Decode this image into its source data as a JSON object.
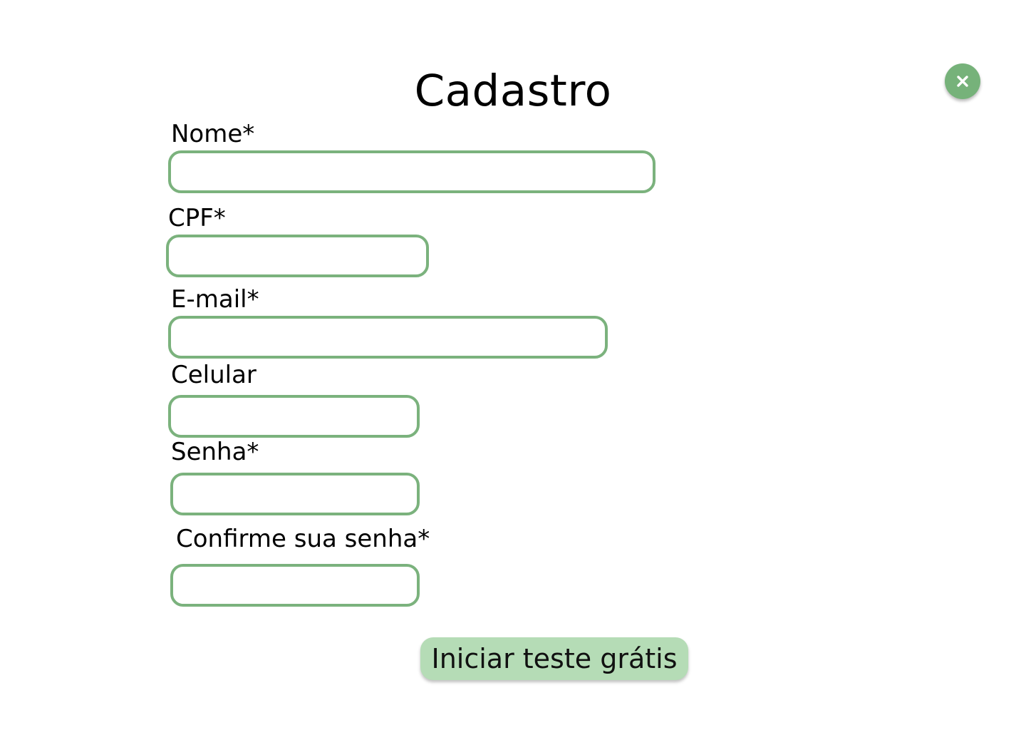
{
  "modal": {
    "title": "Cadastro",
    "close_icon": "close-icon",
    "accent_color": "#7bb27d",
    "button_color": "#b5dcb6"
  },
  "form": {
    "nome": {
      "label": "Nome*",
      "value": ""
    },
    "cpf": {
      "label": "CPF*",
      "value": ""
    },
    "email": {
      "label": "E-mail*",
      "value": ""
    },
    "celular": {
      "label": "Celular",
      "value": ""
    },
    "senha": {
      "label": "Senha*",
      "value": ""
    },
    "confirme_senha": {
      "label": "Confirme sua senha*",
      "value": ""
    },
    "submit_label": "Iniciar teste grátis"
  }
}
